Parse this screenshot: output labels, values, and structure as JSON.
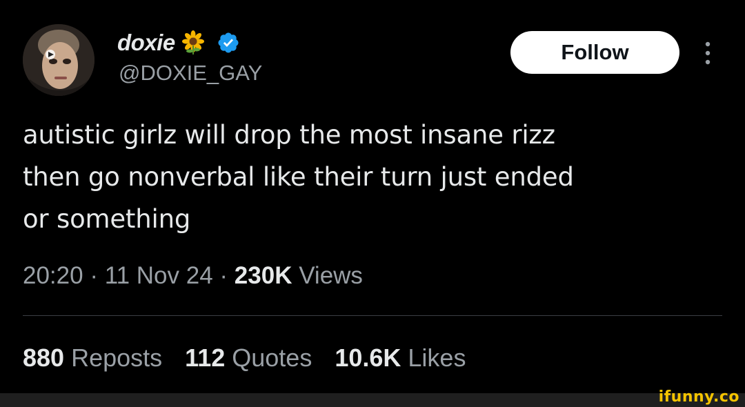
{
  "user": {
    "display_name": "doxie",
    "handle": "@DOXIE_GAY"
  },
  "icons": {
    "name_emoji": "sunflower-icon",
    "verified": "verified-icon",
    "more": "more-icon"
  },
  "follow_label": "Follow",
  "tweet": {
    "text_lines": [
      "autistic girlz will drop the most insane rizz",
      "then go nonverbal like their turn just ended",
      "or something"
    ],
    "time": "20:20",
    "date": "11 Nov 24",
    "views_count": "230K",
    "views_label": "Views"
  },
  "stats": [
    {
      "count": "880",
      "label": "Reposts"
    },
    {
      "count": "112",
      "label": "Quotes"
    },
    {
      "count": "10.6K",
      "label": "Likes"
    }
  ],
  "colors": {
    "background": "#000000",
    "text": "#e7e9ea",
    "secondary": "#9aa0a6",
    "verified": "#1d9bf0",
    "watermark": "#f5c400"
  },
  "watermark": "ifunny.co"
}
